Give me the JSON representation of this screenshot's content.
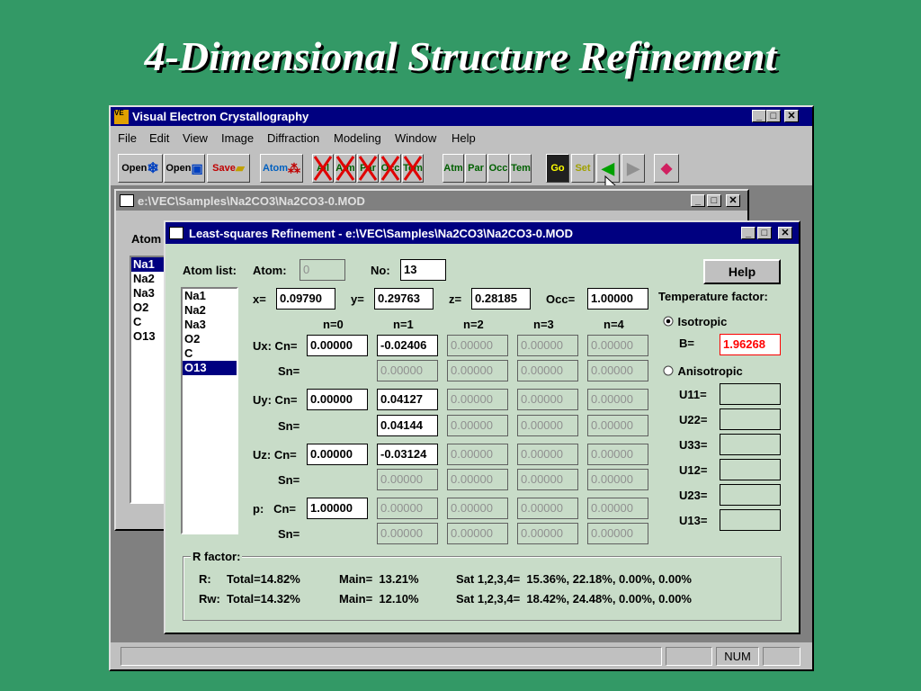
{
  "slide": {
    "title": "4-Dimensional Structure Refinement"
  },
  "app": {
    "title": "Visual Electron Crystallography",
    "menu": [
      "File",
      "Edit",
      "View",
      "Image",
      "Diffraction",
      "Modeling",
      "Window",
      "Help"
    ],
    "toolbar": {
      "open1": "Open",
      "open2": "Open",
      "save": "Save",
      "atom": "Atom",
      "all": "All",
      "atm_x": "Atm",
      "par_x": "Par",
      "occ_x": "Occ",
      "tem_x": "Tem",
      "atm": "Atm",
      "par": "Par",
      "occ": "Occ",
      "tem": "Tem",
      "go": "Go",
      "set": "Set"
    },
    "status_num": "NUM"
  },
  "docwin": {
    "title": "e:\\VEC\\Samples\\Na2CO3\\Na2CO3-0.MOD",
    "atom_label": "Atom",
    "atoms": [
      "Na1",
      "Na2",
      "Na3",
      "O2",
      "C",
      "O13"
    ]
  },
  "dialog": {
    "title": "Least-squares Refinement - e:\\VEC\\Samples\\Na2CO3\\Na2CO3-0.MOD",
    "atom_list_label": "Atom list:",
    "atom_label": "Atom:",
    "atom_value": "0",
    "no_label": "No:",
    "no_value": "13",
    "help": "Help",
    "atoms": [
      "Na1",
      "Na2",
      "Na3",
      "O2",
      "C",
      "O13"
    ],
    "selected_atom": "O13",
    "x_label": "x=",
    "x": "0.09790",
    "y_label": "y=",
    "y": "0.29763",
    "z_label": "z=",
    "z": "0.28185",
    "occ_label": "Occ=",
    "occ": "1.00000",
    "n_headers": [
      "n=0",
      "n=1",
      "n=2",
      "n=3",
      "n=4"
    ],
    "rows": [
      {
        "label": "Ux: Cn=",
        "values": [
          "0.00000",
          "-0.02406",
          "0.00000",
          "0.00000",
          "0.00000"
        ],
        "enabled": [
          true,
          true,
          false,
          false,
          false
        ]
      },
      {
        "label": "Sn=",
        "values": [
          "",
          "0.00000",
          "0.00000",
          "0.00000",
          "0.00000"
        ],
        "enabled": [
          false,
          false,
          false,
          false,
          false
        ]
      },
      {
        "label": "Uy: Cn=",
        "values": [
          "0.00000",
          "0.04127",
          "0.00000",
          "0.00000",
          "0.00000"
        ],
        "enabled": [
          true,
          true,
          false,
          false,
          false
        ]
      },
      {
        "label": "Sn=",
        "values": [
          "",
          "0.04144",
          "0.00000",
          "0.00000",
          "0.00000"
        ],
        "enabled": [
          false,
          true,
          false,
          false,
          false
        ]
      },
      {
        "label": "Uz: Cn=",
        "values": [
          "0.00000",
          "-0.03124",
          "0.00000",
          "0.00000",
          "0.00000"
        ],
        "enabled": [
          true,
          true,
          false,
          false,
          false
        ]
      },
      {
        "label": "Sn=",
        "values": [
          "",
          "0.00000",
          "0.00000",
          "0.00000",
          "0.00000"
        ],
        "enabled": [
          false,
          false,
          false,
          false,
          false
        ]
      },
      {
        "label": "p:   Cn=",
        "values": [
          "1.00000",
          "0.00000",
          "0.00000",
          "0.00000",
          "0.00000"
        ],
        "enabled": [
          true,
          false,
          false,
          false,
          false
        ]
      },
      {
        "label": "Sn=",
        "values": [
          "",
          "0.00000",
          "0.00000",
          "0.00000",
          "0.00000"
        ],
        "enabled": [
          false,
          false,
          false,
          false,
          false
        ]
      }
    ],
    "temp_label": "Temperature factor:",
    "isotropic": "Isotropic",
    "isotropic_selected": true,
    "b_label": "B=",
    "b_value": "1.96268",
    "anisotropic": "Anisotropic",
    "aniso_labels": [
      "U11=",
      "U22=",
      "U33=",
      "U12=",
      "U23=",
      "U13="
    ],
    "rfactor_label": "R factor:",
    "r_line": {
      "lbl": "R:",
      "total": "Total=14.82%",
      "main": "Main=  13.21%",
      "sat": "Sat 1,2,3,4=  15.36%, 22.18%, 0.00%, 0.00%"
    },
    "rw_line": {
      "lbl": "Rw:",
      "total": "Total=14.32%",
      "main": "Main=  12.10%",
      "sat": "Sat 1,2,3,4=  18.42%, 24.48%, 0.00%, 0.00%"
    }
  },
  "colors": {
    "background": "#339966",
    "titlebar": "#000080",
    "window": "#c0c0c0",
    "dialog_body": "#c8dcc8",
    "b_value": "#ff0000"
  }
}
